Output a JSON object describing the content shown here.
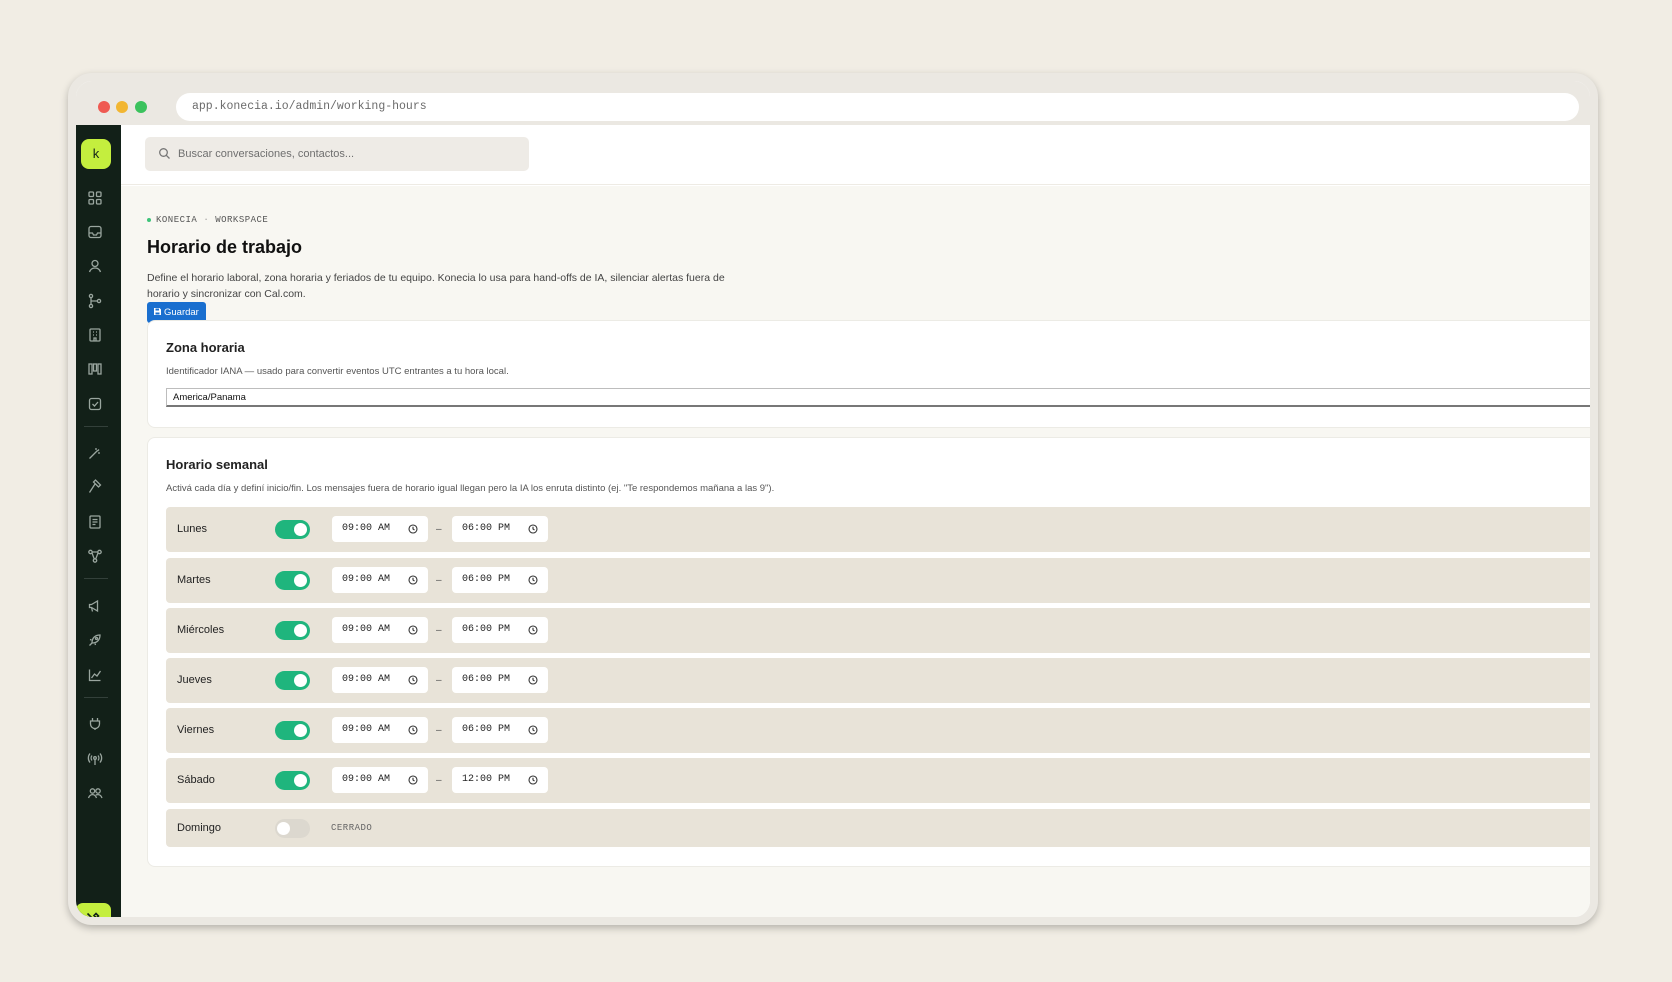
{
  "browser": {
    "url": "app.konecia.io/admin/working-hours"
  },
  "sidebar": {
    "logo": "k",
    "icons": [
      "dashboard-icon",
      "inbox-icon",
      "user-icon",
      "branch-icon",
      "building-icon",
      "kanban-icon",
      "checklist-icon",
      "magic-wand-icon",
      "hammer-icon",
      "book-icon",
      "flow-icon",
      "megaphone-icon",
      "rocket-icon",
      "chart-icon",
      "plug-icon",
      "broadcast-icon",
      "team-icon",
      "tools-icon"
    ],
    "active": "tools-icon"
  },
  "search": {
    "placeholder": "Buscar conversaciones, contactos..."
  },
  "breadcrumb": {
    "org": "KONECIA",
    "section": "WORKSPACE"
  },
  "page": {
    "title": "Horario de trabajo",
    "description": "Define el horario laboral, zona horaria y feriados de tu equipo. Konecia lo usa para hand-offs de IA, silenciar alertas fuera de horario y sincronizar con Cal.com.",
    "save_label": "Guardar"
  },
  "timezone": {
    "title": "Zona horaria",
    "help": "Identificador IANA — usado para convertir eventos UTC entrantes a tu hora local.",
    "value": "America/Panama"
  },
  "weekly": {
    "title": "Horario semanal",
    "help": "Activá cada día y definí inicio/fin. Los mensajes fuera de horario igual llegan pero la IA los enruta distinto (ej. \"Te respondemos mañana a las 9\").",
    "closed_label": "CERRADO",
    "days": [
      {
        "name": "Lunes",
        "enabled": true,
        "start": "09:00 AM",
        "end": "06:00 PM"
      },
      {
        "name": "Martes",
        "enabled": true,
        "start": "09:00 AM",
        "end": "06:00 PM"
      },
      {
        "name": "Miércoles",
        "enabled": true,
        "start": "09:00 AM",
        "end": "06:00 PM"
      },
      {
        "name": "Jueves",
        "enabled": true,
        "start": "09:00 AM",
        "end": "06:00 PM"
      },
      {
        "name": "Viernes",
        "enabled": true,
        "start": "09:00 AM",
        "end": "06:00 PM"
      },
      {
        "name": "Sábado",
        "enabled": true,
        "start": "09:00 AM",
        "end": "12:00 PM"
      },
      {
        "name": "Domingo",
        "enabled": false
      }
    ]
  },
  "colors": {
    "accent": "#c4ee3e",
    "toggle_on": "#1fb57d",
    "primary_button": "#1a6fcf",
    "sidebar": "#122018"
  }
}
